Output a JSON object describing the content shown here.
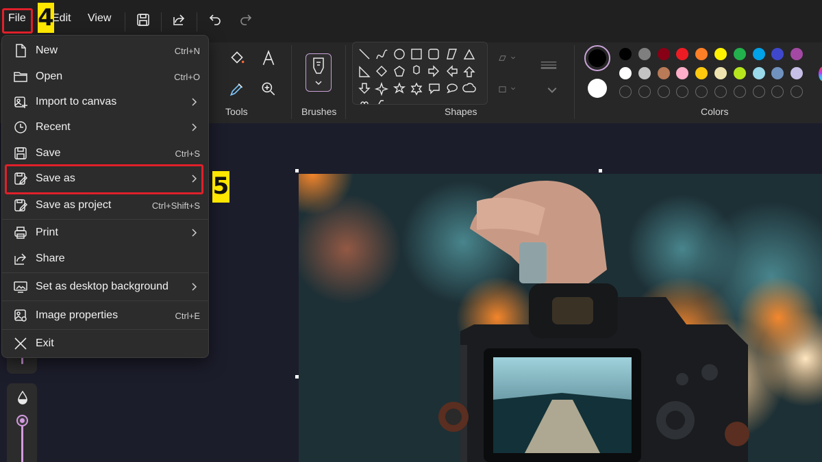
{
  "menubar": {
    "file": "File",
    "edit": "Edit",
    "view": "View",
    "icons": [
      "save-icon",
      "share-icon",
      "undo-icon",
      "redo-icon"
    ]
  },
  "ribbon": {
    "groups": {
      "tools": "Tools",
      "brushes": "Brushes",
      "shapes": "Shapes",
      "colors": "Colors"
    },
    "palette": {
      "row1": [
        "#000000",
        "#7f7f7f",
        "#880015",
        "#ed1c24",
        "#ff7f27",
        "#fff200",
        "#22b14c",
        "#00a2e8",
        "#3f48cc",
        "#a349a4"
      ],
      "row2": [
        "#ffffff",
        "#c3c3c3",
        "#b97a57",
        "#ffaec9",
        "#ffc90e",
        "#efe4b0",
        "#b5e61d",
        "#99d9ea",
        "#7092be",
        "#c8bfe7"
      ],
      "primary": "#000000",
      "secondary": "#ffffff",
      "accent": "#c9a3d8"
    }
  },
  "file_menu": {
    "items": [
      {
        "label": "New",
        "shortcut": "Ctrl+N",
        "icon": "new-file-icon"
      },
      {
        "label": "Open",
        "shortcut": "Ctrl+O",
        "icon": "folder-icon"
      },
      {
        "label": "Import to canvas",
        "shortcut": "",
        "icon": "import-icon",
        "submenu": true
      },
      {
        "label": "Recent",
        "shortcut": "",
        "icon": "clock-icon",
        "submenu": true
      },
      {
        "label": "Save",
        "shortcut": "Ctrl+S",
        "icon": "save-icon"
      },
      {
        "label": "Save as",
        "shortcut": "",
        "icon": "save-as-icon",
        "submenu": true
      },
      {
        "label": "Save as project",
        "shortcut": "Ctrl+Shift+S",
        "icon": "save-project-icon"
      },
      {
        "label": "Print",
        "shortcut": "",
        "icon": "printer-icon",
        "submenu": true
      },
      {
        "label": "Share",
        "shortcut": "",
        "icon": "share-icon"
      },
      {
        "label": "Set as desktop background",
        "shortcut": "",
        "icon": "desktop-background-icon",
        "submenu": true
      },
      {
        "label": "Image properties",
        "shortcut": "Ctrl+E",
        "icon": "image-properties-icon"
      },
      {
        "label": "Exit",
        "shortcut": "",
        "icon": "close-icon"
      }
    ]
  },
  "annotations": {
    "step4": "4",
    "step5": "5",
    "highlight_color": "#e0202a",
    "badge_color": "#ffe600"
  }
}
